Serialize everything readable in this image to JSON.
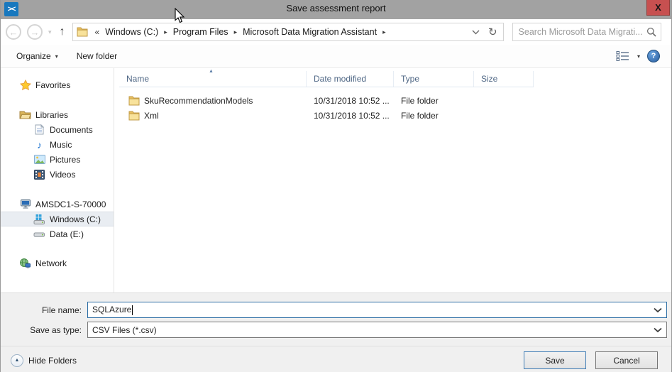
{
  "window": {
    "title": "Save assessment report"
  },
  "glyphs": {
    "close": "X",
    "back": "←",
    "forward": "→",
    "nav_caret": "▾",
    "up": "↑",
    "crumb_overflow": "«",
    "crumb_sep": "▸",
    "addr_caret": "⌄",
    "refresh": "↻",
    "organize_caret": "▾",
    "view_caret": "▾",
    "help": "?",
    "sort_asc": "▲",
    "music_note": "♪",
    "field_caret": "⌄",
    "hide_tri": "▲",
    "app_mark": "><"
  },
  "nav": {
    "breadcrumb": {
      "overflow": "«",
      "items": [
        "Windows (C:)",
        "Program Files",
        "Microsoft Data Migration Assistant"
      ]
    },
    "search": {
      "placeholder": "Search Microsoft Data Migrati..."
    }
  },
  "toolbar": {
    "organize_label": "Organize",
    "new_folder_label": "New folder"
  },
  "sidebar": {
    "groups": [
      {
        "label": "Favorites"
      },
      {
        "label": "Libraries",
        "items": [
          "Documents",
          "Music",
          "Pictures",
          "Videos"
        ]
      },
      {
        "label": "AMSDC1-S-70000",
        "items": [
          "Windows (C:)",
          "Data (E:)"
        ]
      },
      {
        "label": "Network"
      }
    ],
    "selected_item": "Windows (C:)"
  },
  "filelist": {
    "columns": [
      "Name",
      "Date modified",
      "Type",
      "Size"
    ],
    "rows": [
      {
        "name": "SkuRecommendationModels",
        "date_modified": "10/31/2018 10:52 ...",
        "type": "File folder",
        "size": ""
      },
      {
        "name": "Xml",
        "date_modified": "10/31/2018 10:52 ...",
        "type": "File folder",
        "size": ""
      }
    ]
  },
  "fields": {
    "file_name_label": "File name:",
    "file_name_value": "SQLAzure",
    "save_as_type_label": "Save as type:",
    "save_as_type_value": "CSV Files (*.csv)"
  },
  "footer": {
    "hide_folders_label": "Hide Folders",
    "save_label": "Save",
    "cancel_label": "Cancel"
  },
  "colors": {
    "titlebar": "#a2a2a2",
    "close_button": "#c75050",
    "file_name_border": "#2c6da4",
    "save_border": "#3f7cb5",
    "selection_bg": "#e9edf2",
    "header_text": "#4f6785",
    "app_icon_blue": "#1878be"
  }
}
